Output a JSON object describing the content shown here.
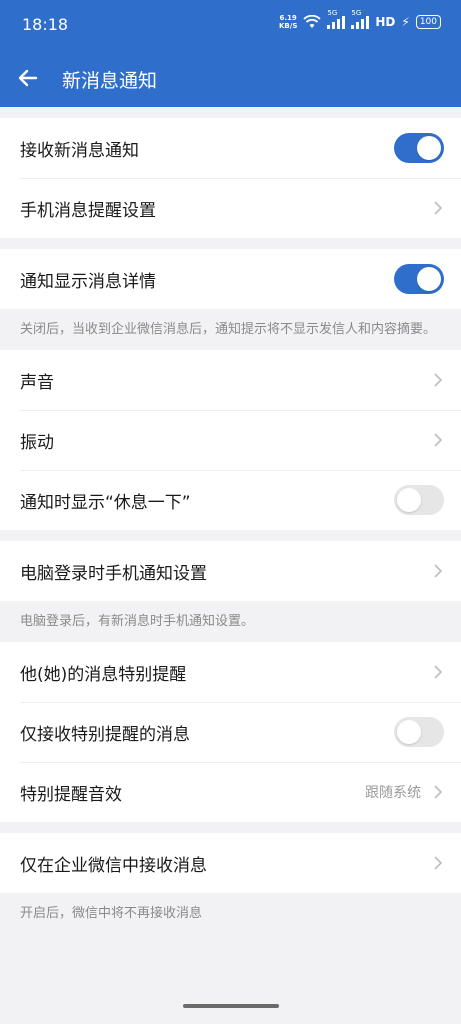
{
  "status_bar": {
    "time": "18:18",
    "net_speed_value": "6.19",
    "net_speed_unit": "KB/S",
    "sig1_tag": "5G",
    "sig2_tag": "5G",
    "hd": "HD",
    "battery": "100"
  },
  "header": {
    "title": "新消息通知"
  },
  "group1": {
    "receive_label": "接收新消息通知",
    "receive_on": true,
    "phone_remind_label": "手机消息提醒设置"
  },
  "group2": {
    "detail_label": "通知显示消息详情",
    "detail_on": true,
    "detail_note": "关闭后，当收到企业微信消息后，通知提示将不显示发信人和内容摘要。"
  },
  "group3": {
    "sound_label": "声音",
    "vibrate_label": "振动",
    "rest_label": "通知时显示“休息一下”",
    "rest_on": false
  },
  "group4": {
    "pc_label": "电脑登录时手机通知设置",
    "pc_note": "电脑登录后，有新消息时手机通知设置。"
  },
  "group5": {
    "special_label": "他(她)的消息特别提醒",
    "only_special_label": "仅接收特别提醒的消息",
    "only_special_on": false,
    "special_sound_label": "特别提醒音效",
    "special_sound_value": "跟随系统"
  },
  "group6": {
    "only_wecom_label": "仅在企业微信中接收消息",
    "only_wecom_note": "开启后，微信中将不再接收消息"
  },
  "colors": {
    "accent": "#2F6FCB",
    "toggle_off": "#E6E6E6",
    "background": "#F2F2F4"
  }
}
